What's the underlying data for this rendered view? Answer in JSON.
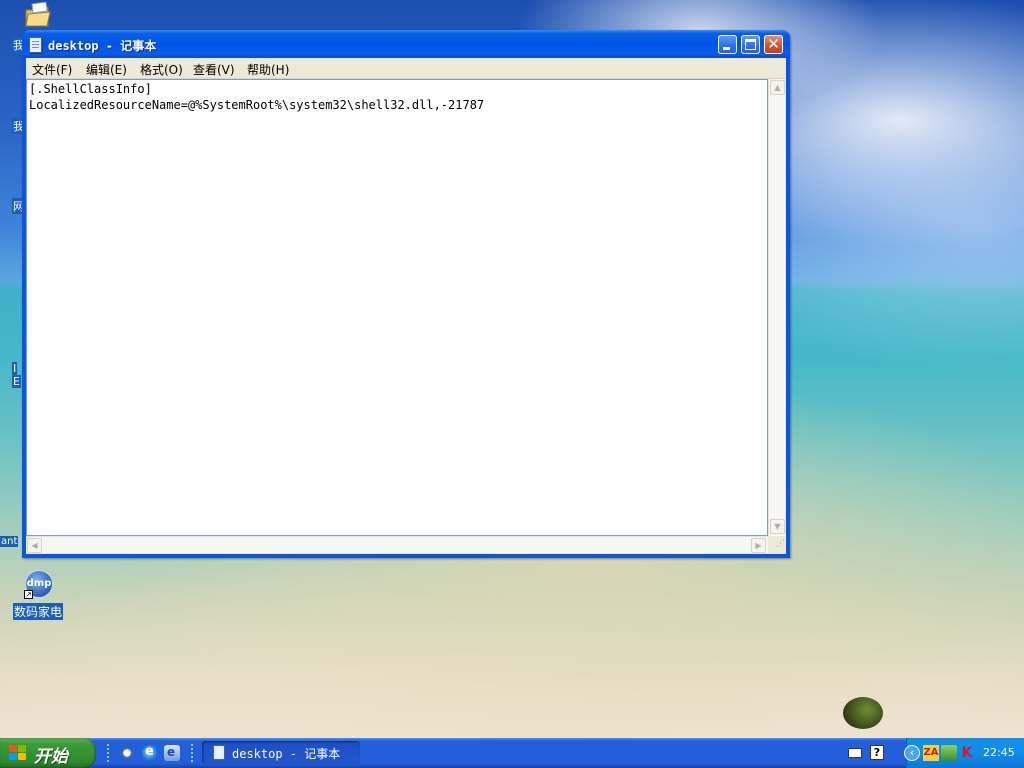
{
  "window": {
    "title": "desktop - 记事本",
    "menu": [
      {
        "label": "文件(F)"
      },
      {
        "label": "编辑(E)"
      },
      {
        "label": "格式(O)"
      },
      {
        "label": "查看(V)"
      },
      {
        "label": "帮助(H)"
      }
    ],
    "content_lines": [
      "[.ShellClassInfo]",
      "LocalizedResourceName=@%SystemRoot%\\system32\\shell32.dll,-21787"
    ]
  },
  "desktop": {
    "shortcut_label": "数码家电",
    "shortcut_icon_text": "dmp",
    "edge_labels": [
      "我",
      "我",
      "网",
      "I",
      "E",
      "ant"
    ]
  },
  "taskbar": {
    "start_label": "开始",
    "task_button_label": "desktop - 记事本",
    "clock": "22:45",
    "tray_za_text": "ZA",
    "tray_k_text": "K",
    "tray_help_text": "?"
  },
  "colors": {
    "title_bar": "#0054e3",
    "taskbar": "#245edb",
    "start_button": "#3a9c3a",
    "tray": "#0d8dea"
  }
}
